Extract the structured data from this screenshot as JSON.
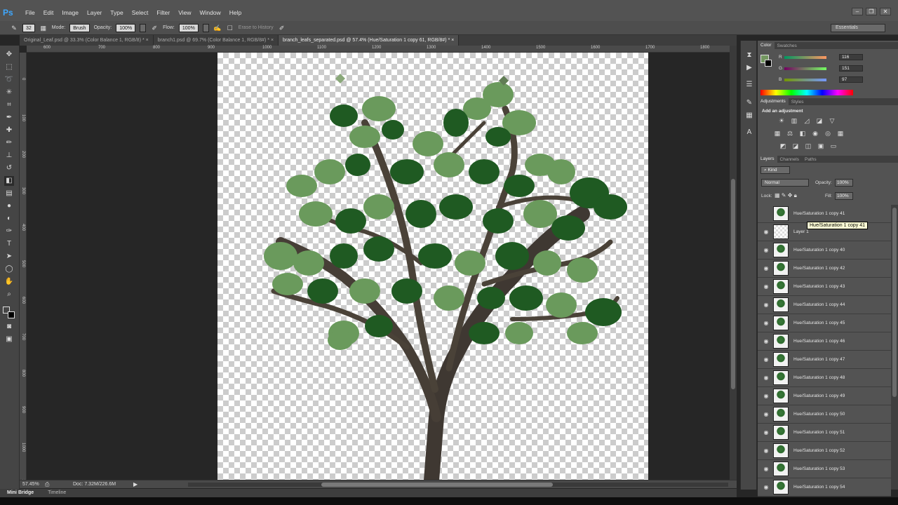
{
  "app": {
    "logo": "Ps"
  },
  "menu": [
    "File",
    "Edit",
    "Image",
    "Layer",
    "Type",
    "Select",
    "Filter",
    "View",
    "Window",
    "Help"
  ],
  "window_controls": [
    "–",
    "❐",
    "✕"
  ],
  "options": {
    "brush_size": "32",
    "mode_label": "Mode:",
    "mode_value": "Brush",
    "opacity_label": "Opacity:",
    "opacity_value": "100%",
    "flow_label": "Flow:",
    "flow_value": "100%",
    "erase_history": "Erase to History"
  },
  "workspace": "Essentials",
  "tabs": [
    {
      "label": "Original_Leaf.psd @ 33.3% (Color Balance 1, RGB/8) *",
      "active": false
    },
    {
      "label": "branch1.psd @ 69.7% (Color Balance 1, RGB/8#) *",
      "active": false
    },
    {
      "label": "branch_leafs_separated.psd @ 57.4% (Hue/Saturation 1 copy 61, RGB/8#) *",
      "active": true
    }
  ],
  "ruler_h": [
    "600",
    "700",
    "800",
    "900",
    "1000",
    "1100",
    "1200",
    "1300",
    "1400",
    "1500",
    "1600",
    "1700",
    "1800"
  ],
  "ruler_v": [
    "0",
    "100",
    "200",
    "300",
    "400",
    "500",
    "600",
    "700",
    "800",
    "900",
    "1000",
    "1100"
  ],
  "status": {
    "zoom": "57.45%",
    "doc": "Doc: 7.32M/226.6M"
  },
  "bottom_tabs": [
    "Mini Bridge",
    "Timeline"
  ],
  "color_panel": {
    "tabs": [
      "Color",
      "Swatches"
    ],
    "r": "116",
    "g": "151",
    "b": "97",
    "r_label": "R",
    "g_label": "G",
    "b_label": "B",
    "fg_color": "#749761",
    "bg_color": "#000000"
  },
  "adjustments": {
    "tabs": [
      "Adjustments",
      "Styles"
    ],
    "title": "Add an adjustment"
  },
  "layers_panel": {
    "tabs": [
      "Layers",
      "Channels",
      "Paths"
    ],
    "kind": "Kind",
    "blend": "Normal",
    "opacity_label": "Opacity:",
    "opacity_value": "100%",
    "lock_label": "Lock:",
    "fill_label": "Fill:",
    "fill_value": "100%",
    "tooltip": "Hue/Saturation 1 copy 41",
    "layers": [
      {
        "name": "Hue/Saturation 1 copy 41",
        "visible": false,
        "thumb": "leaf"
      },
      {
        "name": "Layer 1",
        "visible": true,
        "thumb": "chk"
      },
      {
        "name": "Hue/Saturation 1 copy 40",
        "visible": true,
        "thumb": "leaf"
      },
      {
        "name": "Hue/Saturation 1 copy 42",
        "visible": true,
        "thumb": "leaf"
      },
      {
        "name": "Hue/Saturation 1 copy 43",
        "visible": true,
        "thumb": "leaf"
      },
      {
        "name": "Hue/Saturation 1 copy 44",
        "visible": true,
        "thumb": "leaf"
      },
      {
        "name": "Hue/Saturation 1 copy 45",
        "visible": true,
        "thumb": "leaf"
      },
      {
        "name": "Hue/Saturation 1 copy 46",
        "visible": true,
        "thumb": "leaf"
      },
      {
        "name": "Hue/Saturation 1 copy 47",
        "visible": true,
        "thumb": "leaf"
      },
      {
        "name": "Hue/Saturation 1 copy 48",
        "visible": true,
        "thumb": "leaf"
      },
      {
        "name": "Hue/Saturation 1 copy 49",
        "visible": true,
        "thumb": "leaf"
      },
      {
        "name": "Hue/Saturation 1 copy 50",
        "visible": true,
        "thumb": "leaf"
      },
      {
        "name": "Hue/Saturation 1 copy 51",
        "visible": true,
        "thumb": "leaf"
      },
      {
        "name": "Hue/Saturation 1 copy 52",
        "visible": true,
        "thumb": "leaf"
      },
      {
        "name": "Hue/Saturation 1 copy 53",
        "visible": true,
        "thumb": "leaf"
      },
      {
        "name": "Hue/Saturation 1 copy 54",
        "visible": true,
        "thumb": "leaf"
      }
    ]
  },
  "colors": {
    "leaf_dark": "#1f5a22",
    "leaf_light": "#6a9a5c",
    "bark": "#4a4238"
  }
}
